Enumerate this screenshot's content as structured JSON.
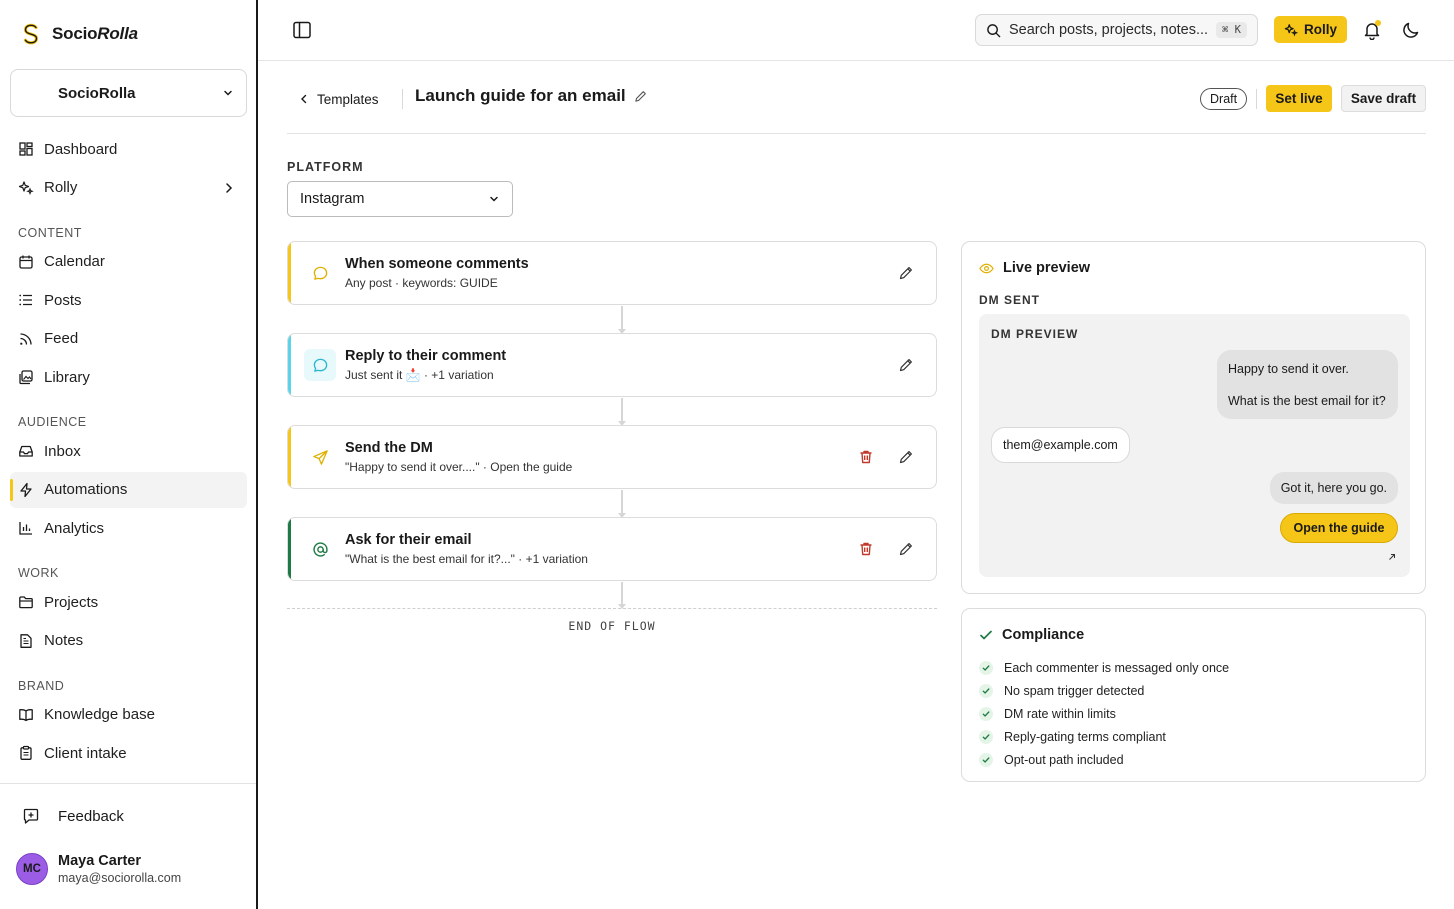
{
  "sidebar": {
    "brand": {
      "name_a": "Socio",
      "name_b": "Rolla"
    },
    "workspace": "SocioRolla",
    "items_top": [
      {
        "label": "Dashboard"
      },
      {
        "label": "Rolly"
      }
    ],
    "sections": {
      "content": "CONTENT",
      "audience": "AUDIENCE",
      "work": "WORK",
      "brand": "BRAND"
    },
    "content_items": [
      {
        "label": "Calendar"
      },
      {
        "label": "Posts"
      },
      {
        "label": "Feed"
      },
      {
        "label": "Library"
      }
    ],
    "audience_items": [
      {
        "label": "Inbox"
      },
      {
        "label": "Automations"
      },
      {
        "label": "Analytics"
      }
    ],
    "work_items": [
      {
        "label": "Projects"
      },
      {
        "label": "Notes"
      }
    ],
    "brand_items": [
      {
        "label": "Knowledge base"
      },
      {
        "label": "Client intake"
      }
    ],
    "feedback": "Feedback",
    "user": {
      "initials": "MC",
      "name": "Maya Carter",
      "email": "maya@sociorolla.com"
    }
  },
  "topbar": {
    "search_placeholder": "Search posts, projects, notes...",
    "shortcut": "⌘ K",
    "rolly_label": "Rolly"
  },
  "header": {
    "back_label": "Templates",
    "title": "Launch guide for an email",
    "status": "Draft",
    "set_live": "Set live",
    "save_draft": "Save draft"
  },
  "platform": {
    "label": "PLATFORM",
    "selected": "Instagram"
  },
  "flow": {
    "steps": [
      {
        "title": "When someone comments",
        "subtitle": "Any post · keywords: GUIDE"
      },
      {
        "title": "Reply to their comment",
        "subtitle": "Just sent it 📩 · +1 variation"
      },
      {
        "title": "Send the DM",
        "subtitle": "\"Happy to send it over....\" · Open the guide"
      },
      {
        "title": "Ask for their email",
        "subtitle": "\"What is the best email for it?...\" · +1 variation"
      }
    ],
    "end_label": "END OF FLOW"
  },
  "preview": {
    "title": "Live preview",
    "stage": "DM SENT",
    "box_label": "DM PREVIEW",
    "msg1_line1": "Happy to send it over.",
    "msg1_line2": "What is the best email for it?",
    "reply": "them@example.com",
    "msg2": "Got it, here you go.",
    "cta": "Open the guide"
  },
  "compliance": {
    "title": "Compliance",
    "items": [
      "Each commenter is messaged only once",
      "No spam trigger detected",
      "DM rate within limits",
      "Reply-gating terms compliant",
      "Opt-out path included"
    ]
  },
  "colors": {
    "accent": "#f5c518",
    "reply_accent": "#5bd3e8",
    "email_accent": "#1e7a45",
    "danger": "#c0392b",
    "avatar": "#9b5de5"
  }
}
